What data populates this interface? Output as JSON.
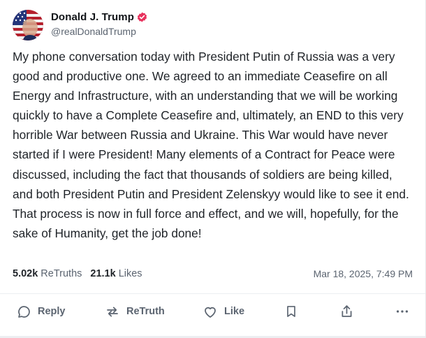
{
  "post": {
    "author": {
      "display_name": "Donald J. Trump",
      "handle": "@realDonaldTrump",
      "verified": true
    },
    "text": "My phone conversation today with President Putin of Russia was a very good and productive one. We agreed to an immediate Ceasefire on all Energy and Infrastructure, with an understanding that we will be working quickly to have a Complete Ceasefire and, ultimately, an END to this very horrible War between Russia and Ukraine. This War would have never started if I were President! Many elements of a Contract for Peace were discussed, including the fact that thousands of soldiers are being killed, and both President Putin and President Zelenskyy would like to see it end. That process is now in full force and effect, and we will, hopefully, for the sake of Humanity, get the job done!",
    "stats": {
      "retruths_count": "5.02k",
      "retruths_label": "ReTruths",
      "likes_count": "21.1k",
      "likes_label": "Likes"
    },
    "timestamp": "Mar 18, 2025, 7:49 PM"
  },
  "actions": {
    "reply_label": "Reply",
    "retruth_label": "ReTruth",
    "like_label": "Like"
  },
  "icons": {
    "reply": "speech-bubble-icon",
    "retruth": "repost-arrows-icon",
    "like": "heart-icon",
    "bookmark": "bookmark-icon",
    "share": "share-icon",
    "more": "more-dots-icon",
    "verified": "verified-badge-icon"
  },
  "colors": {
    "verified_badge": "#e8325d",
    "muted_text": "#5b6470",
    "body_text": "#1f2328"
  }
}
